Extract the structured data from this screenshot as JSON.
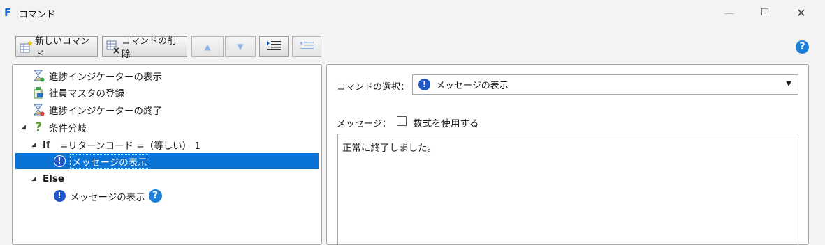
{
  "window": {
    "title": "コマンド",
    "logo": "F",
    "minimize_icon": "—",
    "maximize_icon": "☐",
    "close_icon": "✕"
  },
  "toolbar": {
    "new_command_label": "新しいコマンド",
    "delete_command_label": "コマンドの削除",
    "move_up_icon": "▲",
    "move_down_icon": "▼"
  },
  "help_icon": "?",
  "tree": {
    "items": [
      {
        "label": "進捗インジケーターの表示",
        "icon": "hourglass-show-icon"
      },
      {
        "label": "社員マスタの登録",
        "icon": "db-register-icon"
      },
      {
        "label": "進捗インジケーターの終了",
        "icon": "hourglass-end-icon"
      },
      {
        "label": "条件分岐",
        "icon": "question-icon",
        "glyph": "?"
      },
      {
        "label": "If",
        "condition": "=リターンコード =（等しい） 1"
      },
      {
        "label": "メッセージの表示",
        "icon": "exclamation-icon",
        "glyph": "!",
        "selected": true
      },
      {
        "label": "Else"
      },
      {
        "label": "メッセージの表示",
        "icon": "exclamation-icon",
        "glyph": "!",
        "help": "?"
      }
    ],
    "toggle_glyph": "◢"
  },
  "details": {
    "command_select_label": "コマンドの選択：",
    "command_select_value": "メッセージの表示",
    "command_select_icon": "!",
    "dropdown_arrow": "▼",
    "message_label": "メッセージ：",
    "use_formula_label": "数式を使用する",
    "use_formula_checked": false,
    "message_text": "正常に終了しました。"
  },
  "colors": {
    "accent": "#0a74d6",
    "help_blue": "#1d7fd8",
    "exclamation_blue": "#1f57c9",
    "question_green": "#5aa02c"
  }
}
